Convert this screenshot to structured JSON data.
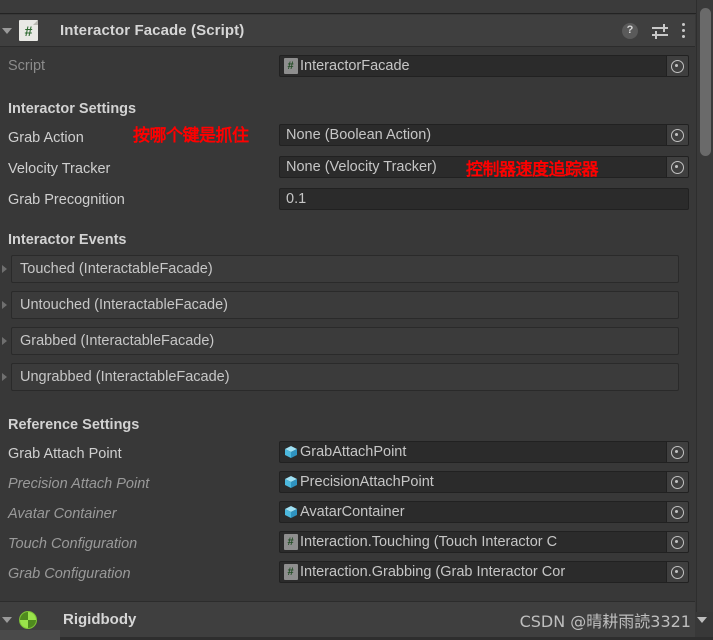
{
  "component": {
    "title": "Interactor Facade (Script)",
    "script_icon": "script-file-icon",
    "script_glyph": "#",
    "header_icons": {
      "help": "?",
      "help_name": "help-icon",
      "preset_name": "preset-icon",
      "menu_name": "kebab-menu-icon"
    }
  },
  "script_row": {
    "label": "Script",
    "value": "InteractorFacade",
    "icon": "script-file-icon"
  },
  "sections": {
    "interactor_settings": {
      "title": "Interactor Settings",
      "fields": [
        {
          "label": "Grab Action",
          "value": "None (Boolean Action)",
          "type": "object",
          "italic": false
        },
        {
          "label": "Velocity Tracker",
          "value": "None (Velocity Tracker)",
          "type": "object",
          "italic": false
        },
        {
          "label": "Grab Precognition",
          "value": "0.1",
          "type": "number",
          "italic": false
        }
      ]
    },
    "interactor_events": {
      "title": "Interactor Events",
      "events": [
        {
          "label": "Touched (InteractableFacade)"
        },
        {
          "label": "Untouched (InteractableFacade)"
        },
        {
          "label": "Grabbed (InteractableFacade)"
        },
        {
          "label": "Ungrabbed (InteractableFacade)"
        }
      ]
    },
    "reference_settings": {
      "title": "Reference Settings",
      "fields": [
        {
          "label": "Grab Attach Point",
          "value": "GrabAttachPoint",
          "icon": "prefab-cube-icon",
          "italic": false
        },
        {
          "label": "Precision Attach Point",
          "value": "PrecisionAttachPoint",
          "icon": "prefab-cube-icon",
          "italic": true
        },
        {
          "label": "Avatar Container",
          "value": "AvatarContainer",
          "icon": "prefab-cube-icon",
          "italic": true
        },
        {
          "label": "Touch Configuration",
          "value": "Interaction.Touching (Touch Interactor C",
          "icon": "script-file-icon",
          "italic": true
        },
        {
          "label": "Grab Configuration",
          "value": "Interaction.Grabbing (Grab Interactor Cor",
          "icon": "script-file-icon",
          "italic": true
        }
      ]
    }
  },
  "annotations": [
    {
      "text": "按哪个键是抓住",
      "name": "annotation-grab-action"
    },
    {
      "text": "控制器速度追踪器",
      "name": "annotation-velocity-tracker"
    }
  ],
  "footer": {
    "title": "Rigidbody",
    "icon": "rigidbody-icon"
  },
  "watermark": {
    "text": "CSDN @晴耕雨読3321"
  },
  "colors": {
    "panel_bg": "#383838",
    "header_bg": "#3f3f3f",
    "field_bg": "#2b2b2b",
    "annotation_red": "#ff0000",
    "rigidbody_green": "#9ae34b"
  }
}
